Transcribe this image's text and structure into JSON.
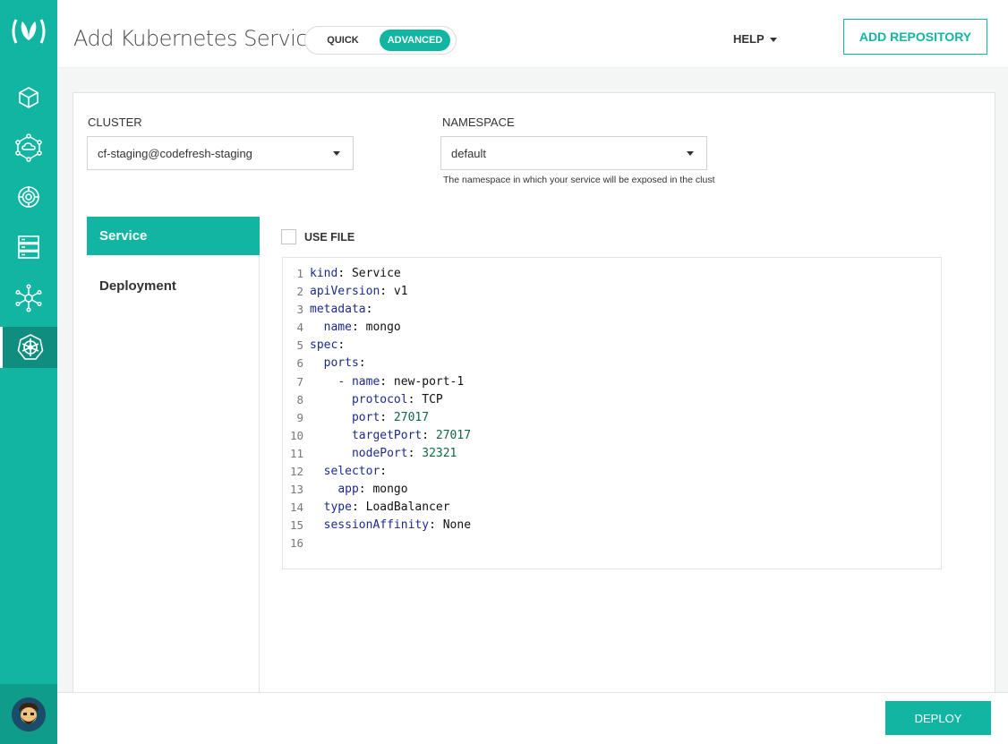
{
  "header": {
    "title": "Add Kubernetes Service",
    "mode_toggle": {
      "quick_label": "QUICK",
      "advanced_label": "ADVANCED",
      "selected": "ADVANCED"
    },
    "help_label": "HELP",
    "add_repository_label": "ADD REPOSITORY"
  },
  "sidebar": {
    "items": [
      {
        "icon": "cube-icon"
      },
      {
        "icon": "cloud-network-icon"
      },
      {
        "icon": "gear-icon"
      },
      {
        "icon": "server-icon"
      },
      {
        "icon": "network-hub-icon"
      },
      {
        "icon": "kubernetes-helm-icon",
        "active": true
      }
    ]
  },
  "form": {
    "cluster_label": "CLUSTER",
    "cluster_value": "cf-staging@codefresh-staging",
    "namespace_label": "NAMESPACE",
    "namespace_value": "default",
    "namespace_hint": "The namespace in which your service will be exposed in the clust"
  },
  "tabs": [
    {
      "label": "Service",
      "active": true
    },
    {
      "label": "Deployment",
      "active": false
    }
  ],
  "use_file_label": "USE FILE",
  "editor": {
    "lines": [
      "kind: Service",
      "apiVersion: v1",
      "metadata:",
      "  name: mongo",
      "spec:",
      "  ports:",
      "    - name: new-port-1",
      "      protocol: TCP",
      "      port: 27017",
      "      targetPort: 27017",
      "      nodePort: 32321",
      "  selector:",
      "    app: mongo",
      "  type: LoadBalancer",
      "  sessionAffinity: None",
      ""
    ]
  },
  "footer": {
    "deploy_label": "DEPLOY"
  },
  "colors": {
    "accent": "#12b5a1",
    "key": "#1d2a8c",
    "number": "#116644"
  }
}
